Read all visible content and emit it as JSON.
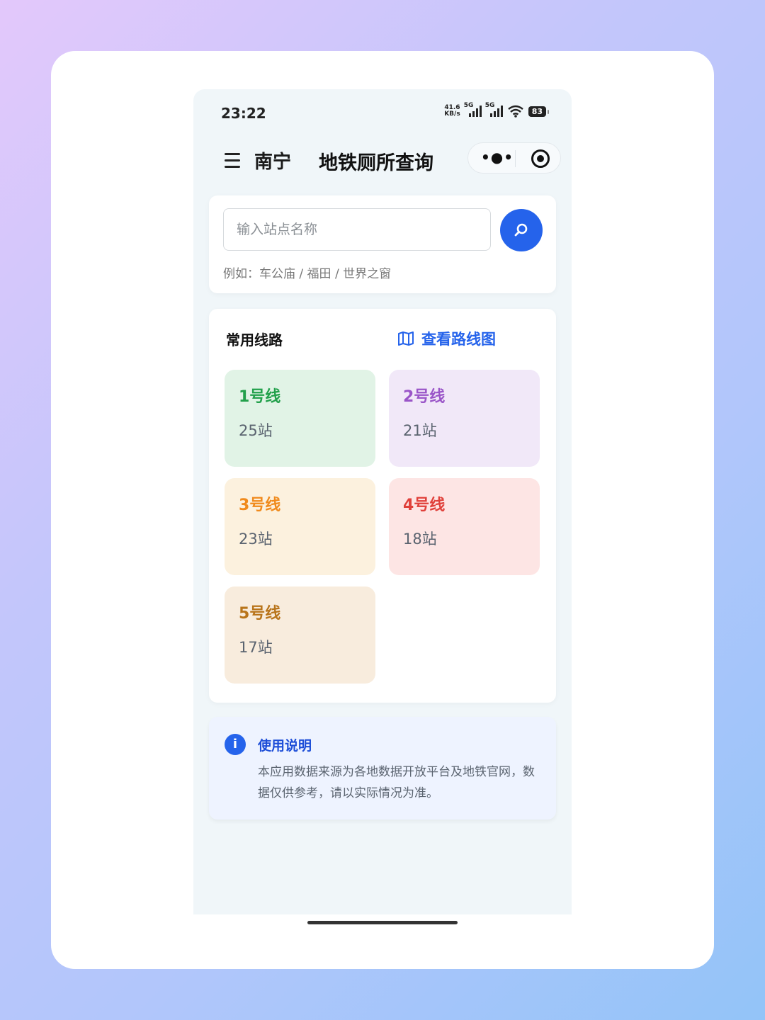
{
  "status_bar": {
    "time": "23:22",
    "net_speed_value": "41.6",
    "net_speed_unit": "KB/s",
    "signal_label_1": "5G",
    "signal_label_2": "5G",
    "battery": "83"
  },
  "nav": {
    "city": "南宁",
    "title": "地铁厕所查询",
    "menu_icon": "hamburger-menu-icon",
    "more_icon": "more-dots-icon",
    "close_icon": "target-circle-icon"
  },
  "search": {
    "placeholder": "输入站点名称",
    "value": "",
    "hint": "例如：车公庙 / 福田 / 世界之窗",
    "button_icon": "search-icon",
    "button_color": "#2563eb"
  },
  "lines": {
    "section_title": "常用线路",
    "map_link_label": "查看路线图",
    "map_link_icon": "map-icon",
    "items": [
      {
        "name": "1号线",
        "count": "25站",
        "color": "#22a04b",
        "bg": "#e1f3e6"
      },
      {
        "name": "2号线",
        "count": "21站",
        "color": "#9a55c8",
        "bg": "#f1e8f8"
      },
      {
        "name": "3号线",
        "count": "23站",
        "color": "#f08a1c",
        "bg": "#fcf1de"
      },
      {
        "name": "4号线",
        "count": "18站",
        "color": "#e0403a",
        "bg": "#fde5e4"
      },
      {
        "name": "5号线",
        "count": "17站",
        "color": "#b8741a",
        "bg": "#f8ecdd"
      }
    ]
  },
  "info": {
    "title": "使用说明",
    "text": "本应用数据来源为各地数据开放平台及地铁官网，数据仅供参考，请以实际情况为准。",
    "icon": "info-icon"
  }
}
